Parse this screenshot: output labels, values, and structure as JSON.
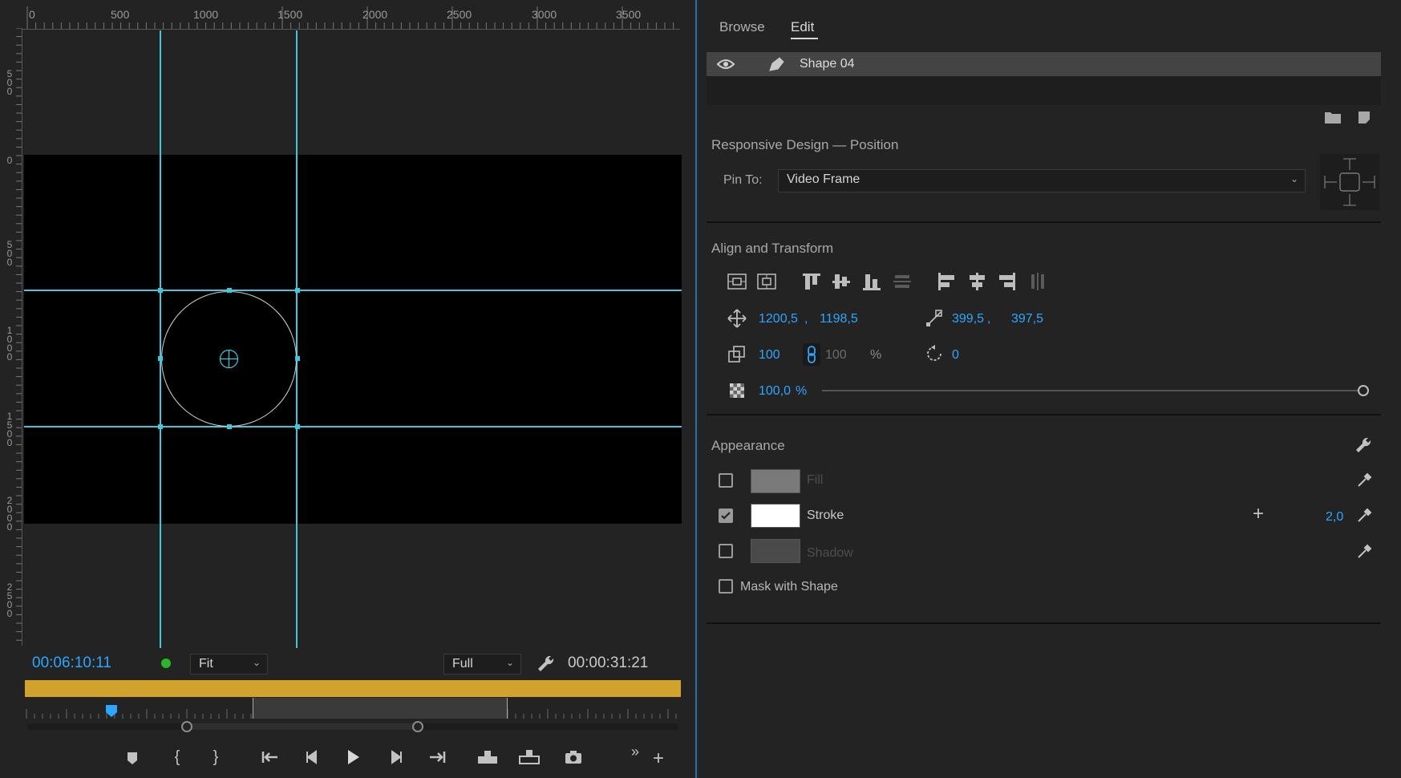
{
  "monitor": {
    "ruler_h_labels": [
      "0",
      "500",
      "1000",
      "1500",
      "2000",
      "2500",
      "3000",
      "3500"
    ],
    "ruler_v_labels": [
      "500",
      "0",
      "500",
      "1000",
      "1500",
      "2000",
      "2500"
    ],
    "timecode_current": "00:06:10:11",
    "timecode_duration": "00:00:31:21",
    "zoom_select": "Fit",
    "quality_select": "Full",
    "status_dot_color": "#2bb52b",
    "accent_color": "#3fc7e0",
    "workarea_color": "#d2a32c",
    "transport_buttons": [
      "add-marker",
      "mark-in",
      "mark-out",
      "go-to-in",
      "step-back",
      "play",
      "step-forward",
      "go-to-out",
      "lift",
      "extract",
      "export-frame",
      "more",
      "add-button"
    ]
  },
  "panel": {
    "tabs": [
      "Browse",
      "Edit"
    ],
    "active_tab": "Edit",
    "layer": {
      "name": "Shape 04"
    },
    "responsive": {
      "title": "Responsive Design — Position",
      "pin_label": "Pin To:",
      "pin_value": "Video Frame"
    },
    "align": {
      "title": "Align and Transform",
      "position_x": "1200,5",
      "position_y": "1198,5",
      "size_w": "399,5",
      "size_h": "397,5",
      "scale": "100",
      "scale_linked": "100",
      "scale_unit": "%",
      "rotation": "0",
      "opacity": "100,0",
      "opacity_unit": "%",
      "opacity_level": 1.0
    },
    "appearance": {
      "title": "Appearance",
      "fill": {
        "label": "Fill",
        "checked": false,
        "color": "#7a7a7a"
      },
      "stroke": {
        "label": "Stroke",
        "checked": true,
        "color": "#ffffff",
        "width": "2,0"
      },
      "shadow": {
        "label": "Shadow",
        "checked": false,
        "color": "#4a4a4a"
      },
      "mask_label": "Mask with Shape"
    }
  }
}
